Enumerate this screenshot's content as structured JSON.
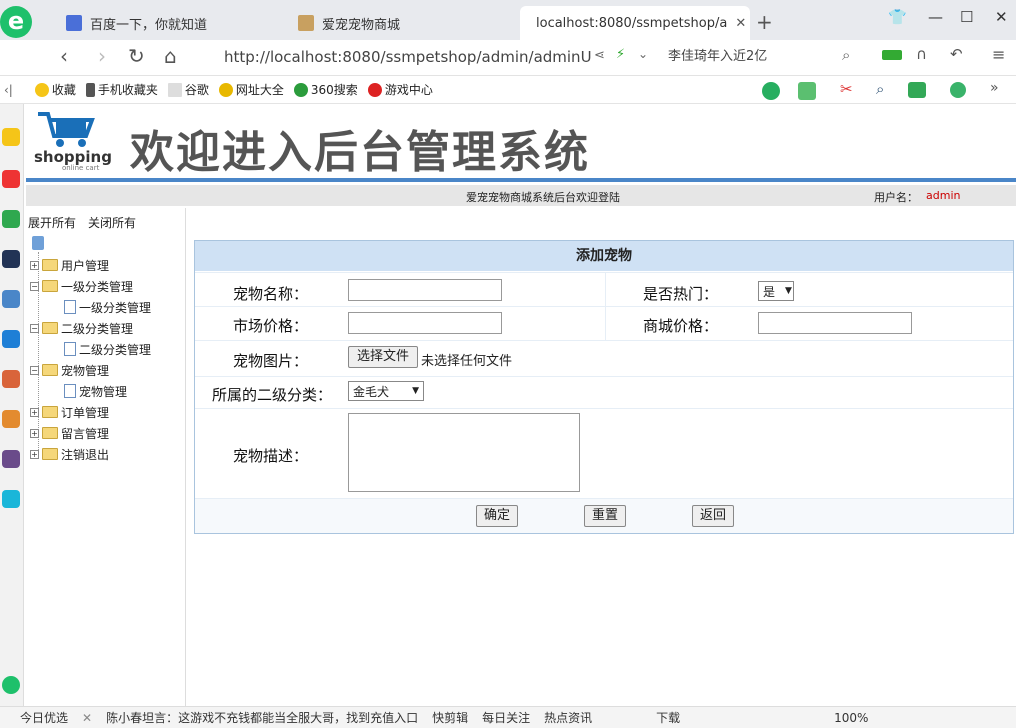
{
  "browser": {
    "tabs": [
      {
        "label": "百度一下，你就知道"
      },
      {
        "label": "爱宠宠物商城"
      },
      {
        "label": "localhost:8080/ssmpetshop/a"
      }
    ],
    "url": "http://localhost:8080/ssmpetshop/admin/adminU",
    "url_host": "localhost",
    "search_text": "李佳琦年入近2亿",
    "bookmarks": [
      "收藏",
      "手机收藏夹",
      "谷歌",
      "网址大全",
      "360搜索",
      "游戏中心"
    ]
  },
  "header": {
    "logo_text": "shopping",
    "logo_sub": "online cart",
    "title": "欢迎进入后台管理系统",
    "welcome": "爱宠宠物商城系统后台欢迎登陆",
    "user_label": "用户名：",
    "username": "admin"
  },
  "tree": {
    "expand_all": "展开所有",
    "collapse_all": "关闭所有",
    "nodes": [
      {
        "label": "用户管理"
      },
      {
        "label": "一级分类管理"
      },
      {
        "label": "一级分类管理"
      },
      {
        "label": "二级分类管理"
      },
      {
        "label": "二级分类管理"
      },
      {
        "label": "宠物管理"
      },
      {
        "label": "宠物管理"
      },
      {
        "label": "订单管理"
      },
      {
        "label": "留言管理"
      },
      {
        "label": "注销退出"
      }
    ]
  },
  "form": {
    "title": "添加宠物",
    "name_label": "宠物名称：",
    "hot_label": "是否热门：",
    "hot_value": "是",
    "market_price_label": "市场价格：",
    "shop_price_label": "商城价格：",
    "image_label": "宠物图片：",
    "file_button": "选择文件",
    "file_status": "未选择任何文件",
    "category_label": "所属的二级分类：",
    "category_value": "金毛犬",
    "desc_label": "宠物描述：",
    "ok_button": "确定",
    "reset_button": "重置",
    "back_button": "返回"
  },
  "statusbar": {
    "items": [
      "今日优选",
      "陈小春坦言：这游戏不充钱都能当全服大哥，找到充值入口",
      "快剪辑",
      "每日关注",
      "热点资讯",
      "下载",
      "100%"
    ]
  },
  "colors": {
    "accent": "#4a86c8",
    "form_header": "#cfe1f4",
    "username": "#cc0000"
  }
}
